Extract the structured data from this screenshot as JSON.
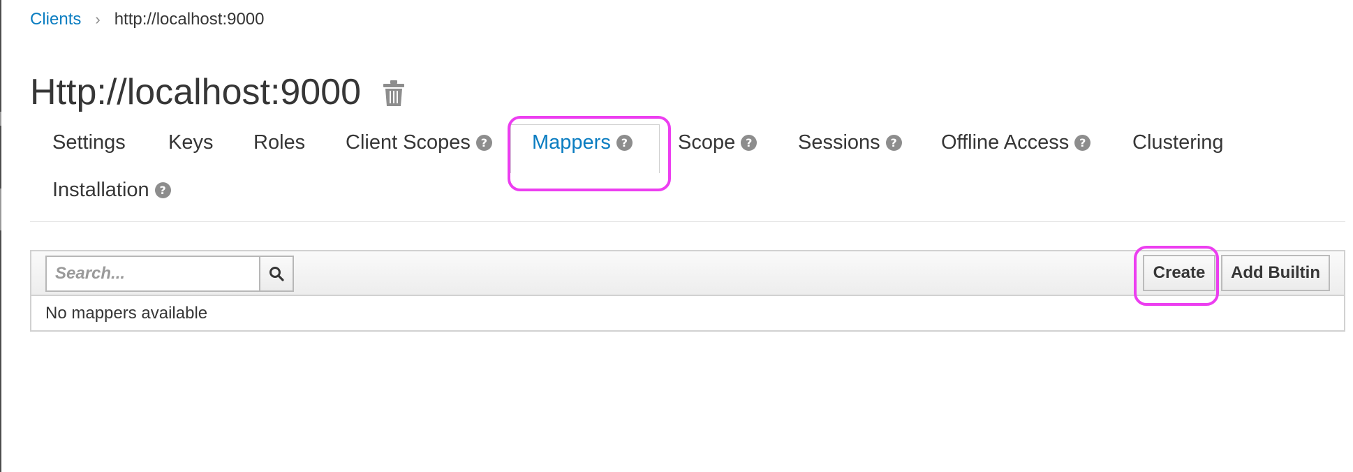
{
  "breadcrumb": {
    "parent_label": "Clients",
    "separator": "›",
    "current_label": "http://localhost:9000"
  },
  "page": {
    "title": "Http://localhost:9000",
    "delete_icon": "trash-icon"
  },
  "tabs": [
    {
      "label": "Settings",
      "help": false,
      "active": false
    },
    {
      "label": "Keys",
      "help": false,
      "active": false
    },
    {
      "label": "Roles",
      "help": false,
      "active": false
    },
    {
      "label": "Client Scopes",
      "help": true,
      "active": false
    },
    {
      "label": "Mappers",
      "help": true,
      "active": true
    },
    {
      "label": "Scope",
      "help": true,
      "active": false
    },
    {
      "label": "Sessions",
      "help": true,
      "active": false
    },
    {
      "label": "Offline Access",
      "help": true,
      "active": false
    },
    {
      "label": "Clustering",
      "help": false,
      "active": false
    },
    {
      "label": "Installation",
      "help": true,
      "active": false
    }
  ],
  "help_glyph": "?",
  "toolbar": {
    "search_placeholder": "Search...",
    "search_icon": "search-icon",
    "create_label": "Create",
    "add_builtin_label": "Add Builtin"
  },
  "table": {
    "empty_message": "No mappers available"
  },
  "colors": {
    "link": "#0b7dc1",
    "highlight": "#ec3ef0",
    "text": "#363636"
  }
}
